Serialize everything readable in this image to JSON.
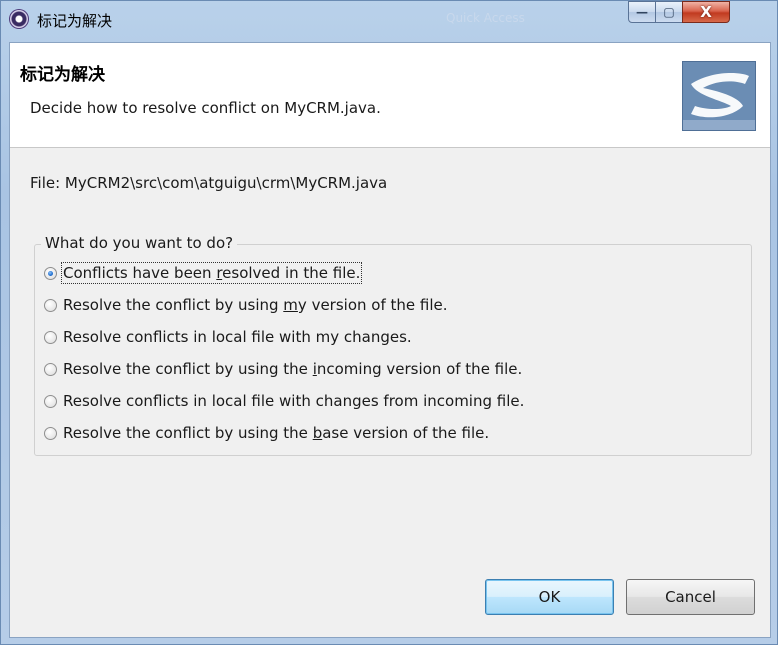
{
  "window": {
    "title": "标记为解决",
    "title_ghost": "Quick Access",
    "minimize_glyph": "—",
    "maximize_glyph": "▢",
    "close_glyph": "X"
  },
  "banner": {
    "title": "标记为解决",
    "description": "Decide how to resolve conflict on MyCRM.java.",
    "logo_icon": "svn-logo-icon"
  },
  "file_line": "File: MyCRM2\\src\\com\\atguigu\\crm\\MyCRM.java",
  "group": {
    "legend": "What do you want to do?",
    "options": [
      {
        "pre": "Conflicts have been ",
        "mn": "r",
        "post": "esolved in the file.",
        "selected": true
      },
      {
        "pre": "Resolve the conflict by using ",
        "mn": "m",
        "post": "y version of the file.",
        "selected": false
      },
      {
        "pre": "Resolve conflicts in local file with my changes.",
        "mn": "",
        "post": "",
        "selected": false
      },
      {
        "pre": "Resolve the conflict by using the ",
        "mn": "i",
        "post": "ncoming version of the file.",
        "selected": false
      },
      {
        "pre": "Resolve conflicts in local file with changes from incoming file.",
        "mn": "",
        "post": "",
        "selected": false
      },
      {
        "pre": "Resolve the conflict by using the ",
        "mn": "b",
        "post": "ase version of the file.",
        "selected": false
      }
    ]
  },
  "buttons": {
    "ok": "OK",
    "cancel": "Cancel"
  },
  "colors": {
    "accent": "#3c7fb1",
    "close_red": "#c13a20",
    "frame_blue": "#b9d1ea"
  }
}
